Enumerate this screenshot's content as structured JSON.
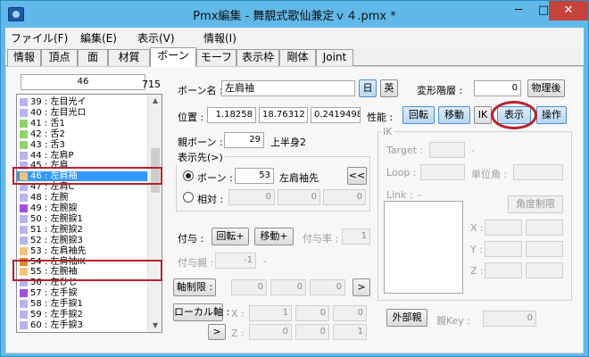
{
  "title": "Pmx編集 - 舞靚式歌仙兼定ｖ４.pmx *",
  "window_buttons": {
    "minimize": "─",
    "maximize": "□",
    "close": "✕"
  },
  "menus": [
    "ファイル(F)",
    "編集(E)",
    "表示(V)",
    "情報(I)"
  ],
  "tabs": [
    "情報",
    "頂点",
    "面",
    "材質",
    "ボーン",
    "モーフ",
    "表示枠",
    "剛体",
    "Joint"
  ],
  "active_tab": "ボーン",
  "list": {
    "index_value": "46",
    "count": "715",
    "items": [
      {
        "label": "39 : 左目光イ",
        "color": "#b8b4ee"
      },
      {
        "label": "40 : 左目光ロ",
        "color": "#b8b4ee"
      },
      {
        "label": "41 : 舌1",
        "color": "#8fd46a"
      },
      {
        "label": "42 : 舌2",
        "color": "#8fd46a"
      },
      {
        "label": "43 : 舌3",
        "color": "#8fd46a"
      },
      {
        "label": "44 : 左肩P",
        "color": "#b8b4ee"
      },
      {
        "label": "45 : 左肩",
        "color": "#b8b4ee"
      },
      {
        "label": "46 : 左肩袖",
        "color": "#f6c37a",
        "selected": true
      },
      {
        "label": "47 : 左肩C",
        "color": "#b8b4ee"
      },
      {
        "label": "48 : 左腕",
        "color": "#b8b4ee"
      },
      {
        "label": "49 : 左腕捩",
        "color": "#a24ee0"
      },
      {
        "label": "50 : 左腕捩1",
        "color": "#b8b4ee"
      },
      {
        "label": "51 : 左腕捩2",
        "color": "#b8b4ee"
      },
      {
        "label": "52 : 左腕捩3",
        "color": "#b8b4ee"
      },
      {
        "label": "53 : 左肩袖先",
        "color": "#f6c37a"
      },
      {
        "label": "54 : 左肩袖IK",
        "color": "#e0862a"
      },
      {
        "label": "55 : 左腕袖",
        "color": "#f6c37a"
      },
      {
        "label": "56 : 左ひじ",
        "color": "#b8b4ee"
      },
      {
        "label": "57 : 左手捩",
        "color": "#a24ee0"
      },
      {
        "label": "58 : 左手捩1",
        "color": "#b8b4ee"
      },
      {
        "label": "59 : 左手捩2",
        "color": "#b8b4ee"
      },
      {
        "label": "60 : 左手捩3",
        "color": "#b8b4ee"
      }
    ]
  },
  "bone": {
    "name_label": "ボーン名 :",
    "name_value": "左肩袖",
    "lang_jp": "日",
    "lang_en": "英",
    "deform_label": "変形階層 :",
    "deform_value": "0",
    "physics_after": "物理後",
    "position_label": "位置 :",
    "pos_x": "1.18258",
    "pos_y": "18.76312",
    "pos_z": "0.2419498",
    "perf_label": "性能 :",
    "perf_rotate": "回転",
    "perf_move": "移動",
    "perf_ik": "IK",
    "perf_show": "表示",
    "perf_operate": "操作",
    "parent_label": "親ボーン :",
    "parent_value": "29",
    "parent_name": "上半身2"
  },
  "display_dest": {
    "label": "表示先(>)",
    "bone_label": "ボーン :",
    "bone_value": "53",
    "bone_name": "左肩袖先",
    "go_button": "<<",
    "relative_label": "相対 :",
    "rel_x": "0",
    "rel_y": "0",
    "rel_z": "0"
  },
  "grant": {
    "label": "付与 :",
    "rotate_plus": "回転+",
    "move_plus": "移動+",
    "rate_label": "付与率 :",
    "rate_value": "1",
    "parent_label": "付与親 :",
    "parent_value": "-1",
    "parent_dash": "-"
  },
  "axis_limit": {
    "label": "軸制限 :",
    "x": "0",
    "y": "0",
    "z": "0",
    "btn": ">"
  },
  "local_axis": {
    "label": "ローカル軸 :",
    "x_label": "X :",
    "z_label": "Z :",
    "x1": "1",
    "x2": "0",
    "x3": "0",
    "z1": "0",
    "z2": "0",
    "z3": "1",
    "btn": ">"
  },
  "ik": {
    "label": "IK",
    "target_label": "Target :",
    "target_dash": "-",
    "loop_label": "Loop :",
    "unit_label": "単位角 :",
    "link_label": "Link :",
    "link_dash": "-",
    "angle_limit": "角度制限",
    "x_label": "X :",
    "y_label": "Y :",
    "z_label": "Z :"
  },
  "external": {
    "button": "外部親",
    "key_label": "親Key :",
    "key_value": "0"
  }
}
